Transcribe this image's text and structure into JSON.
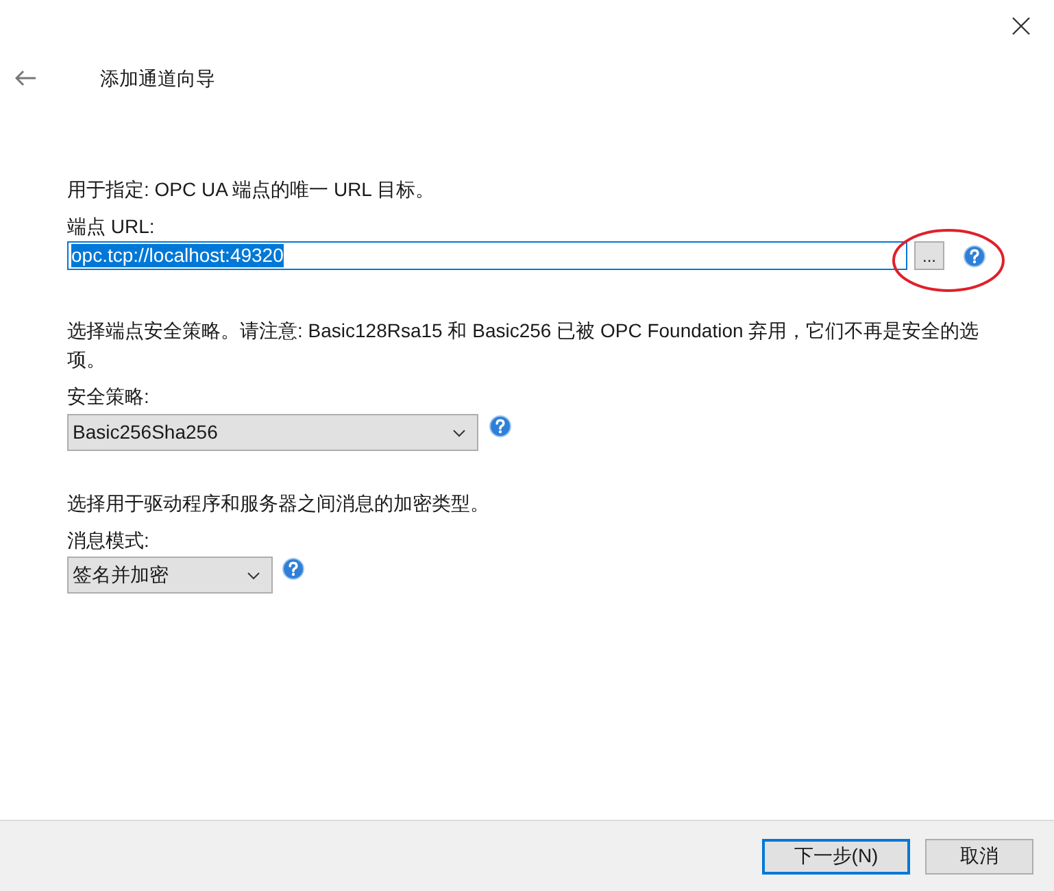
{
  "header": {
    "title": "添加通道向导"
  },
  "endpoint": {
    "description": "用于指定:  OPC UA 端点的唯一 URL 目标。",
    "label": "端点 URL:",
    "value": "opc.tcp://localhost:49320",
    "text_selected": true,
    "browse_button": "..."
  },
  "security": {
    "description": "选择端点安全策略。请注意: Basic128Rsa15 和 Basic256 已被 OPC Foundation 弃用，它们不再是安全的选项。",
    "label": "安全策略:",
    "value": "Basic256Sha256"
  },
  "message_mode": {
    "description": "选择用于驱动程序和服务器之间消息的加密类型。",
    "label": "消息模式:",
    "value": "签名并加密"
  },
  "buttons": [
    {
      "label": "下一步(N)",
      "default": true
    },
    {
      "label": "取消",
      "default": false
    }
  ]
}
